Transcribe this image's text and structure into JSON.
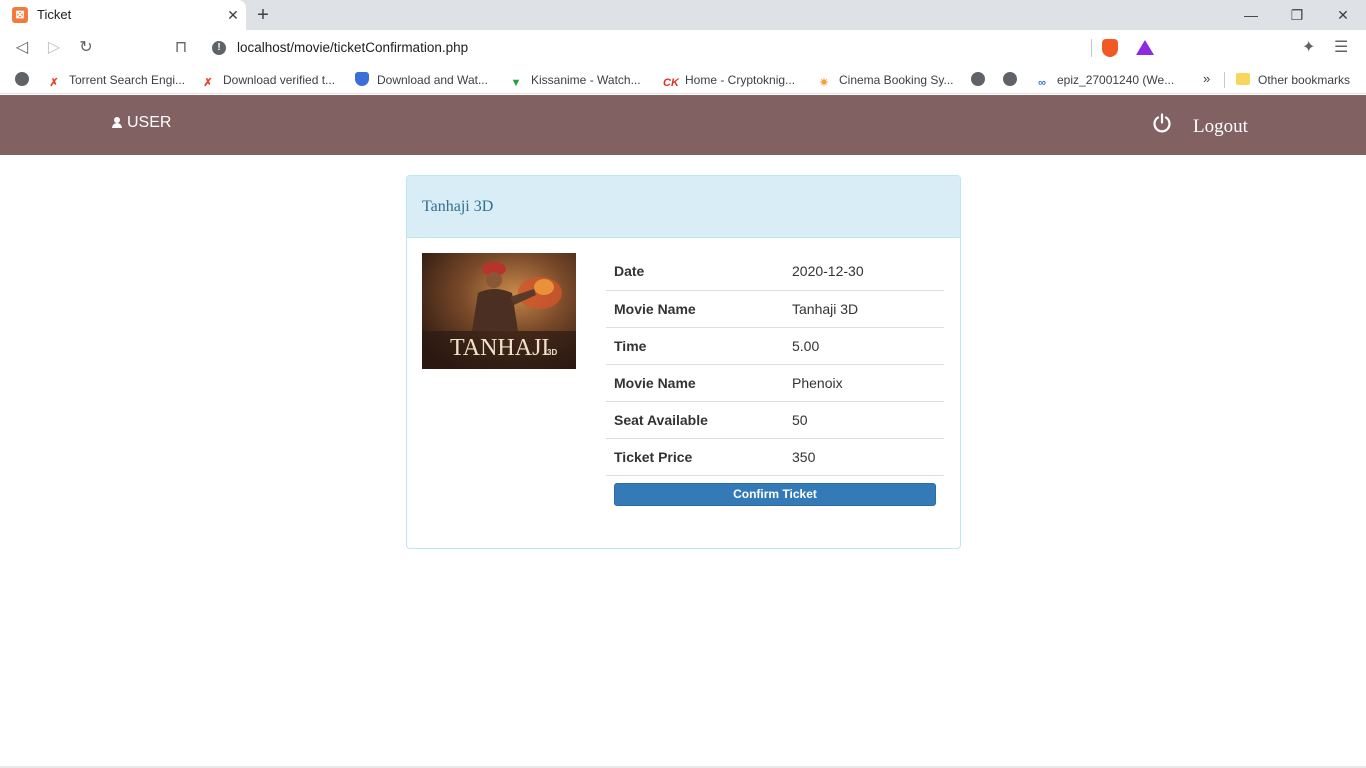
{
  "browser": {
    "tab_title": "Ticket",
    "url": "localhost/movie/ticketConfirmation.php",
    "bookmarks": [
      {
        "label": "Torrent Search Engi...",
        "icon": "x-icon",
        "color": "#e8442c"
      },
      {
        "label": "Download verified t...",
        "icon": "x-icon",
        "color": "#e8442c"
      },
      {
        "label": "Download and Wat...",
        "icon": "shield-icon",
        "color": "#3b6fd8"
      },
      {
        "label": "Kissanime - Watch...",
        "icon": "kissanime-icon",
        "color": "#1fa33c"
      },
      {
        "label": "Home - Cryptoknig...",
        "icon": "ck-icon",
        "color": "#d9342b"
      },
      {
        "label": "Cinema Booking Sy...",
        "icon": "cinema-icon",
        "color": "#f3a13b"
      },
      {
        "label": "",
        "icon": "globe-icon",
        "color": "#5f6368"
      },
      {
        "label": "",
        "icon": "globe-icon",
        "color": "#5f6368"
      },
      {
        "label": "epiz_27001240 (We...",
        "icon": "infinity-icon",
        "color": "#3b6fd8"
      }
    ],
    "other_bookmarks": "Other bookmarks",
    "more_bookmarks": "»"
  },
  "navbar": {
    "user_label": "USER",
    "logout_label": "Logout",
    "background": "#816162"
  },
  "ticket": {
    "title": "Tanhaji 3D",
    "poster_text": "TANHAJI",
    "poster_subtitle": "3D",
    "rows": [
      {
        "label": "Date",
        "value": "2020-12-30"
      },
      {
        "label": "Movie Name",
        "value": "Tanhaji 3D"
      },
      {
        "label": "Time",
        "value": "5.00"
      },
      {
        "label": "Movie Name",
        "value": "Phenoix"
      },
      {
        "label": "Seat Available",
        "value": "50"
      },
      {
        "label": "Ticket Price",
        "value": "350"
      }
    ],
    "confirm_label": "Confirm Ticket"
  }
}
